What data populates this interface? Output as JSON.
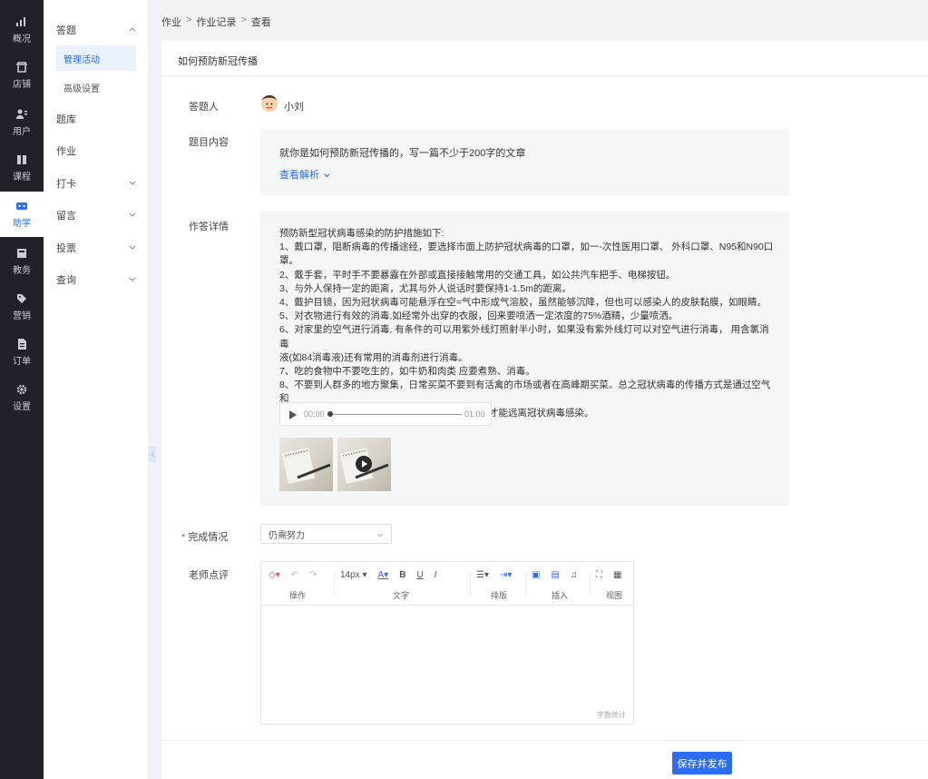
{
  "rail": {
    "items": [
      {
        "label": "概况"
      },
      {
        "label": "店铺"
      },
      {
        "label": "用户"
      },
      {
        "label": "课程"
      },
      {
        "label": "助学"
      },
      {
        "label": "教务"
      },
      {
        "label": "营销"
      },
      {
        "label": "订单"
      },
      {
        "label": "设置"
      }
    ],
    "active_label": "助学"
  },
  "sidebar": {
    "group1": "答题",
    "sub1": "管理活动",
    "sub2": "高级设置",
    "item_tiku": "题库",
    "item_zuoye": "作业",
    "item_daka": "打卡",
    "item_liuyan": "留言",
    "item_toupiao": "投票",
    "item_chaxun": "查询"
  },
  "breadcrumb": {
    "part1": "作业",
    "part2": "作业记录",
    "part3": "查看",
    "sep": ">"
  },
  "card": {
    "title": "如何预防新冠传播"
  },
  "form": {
    "answerer_label": "答题人",
    "answerer_name": "小刘",
    "question_label": "题目内容",
    "question_text": "就你是如何预防新冠传播的，写一篇不少于200字的文章",
    "view_analysis": "查看解析",
    "answer_label": "作答详情",
    "answer_lines": [
      "预防新型冠状病毒感染的防护措施如下:",
      "1、戴口罩，阻断病毒的传播途经，要选择市面上防护冠状病毒的口罩，如一-次性医用口罩、 外科口罩、N95和N90口",
      "罩。",
      "2、戴手套，平时手不要暴露在外部或直接接触常用的交通工具，如公共汽车把手、电梯按钮。",
      "3、与外人保持一定的距离，尤其与外人说话时要保持1-1.5m的距离。",
      "4、戴护目镜，因为冠状病毒可能悬浮在空=气中形成气溶胶，虽然能够沉降，但也可以感染人的皮肤黏膜，如眼睛。",
      "5、对衣物进行有效的消毒,如经常外出穿的衣服，回来要喷洒一定浓度的75%酒精，少量喷洒。",
      "6、对家里的空气进行消毒, 有条件的可以用紫外线灯照射半小时，如果没有紫外线灯可以对空气进行消毒， 用含氯消毒",
      "液(如84消毒液)还有常用的消毒剂进行消毒。",
      "7、吃的食物中不要吃生的，如牛奶和肉类 应要煮熟、消毒。",
      "8、不要到人群多的地方聚集，日常买菜不要到有活禽的市场或者在高峰期买菜。总之冠状病毒的传播方式是通过空气和",
      "呼吸道传播，只有保护好自己，阻断任何传播途径才能远离冠状病毒感染。"
    ],
    "audio_current": "00:00",
    "audio_total": "01:00",
    "audio_progress": 0,
    "completion_label": "完成情况",
    "completion_value": "仍需努力",
    "teacher_comment_label": "老师点评"
  },
  "editor": {
    "font_size": "14px",
    "group_labels": {
      "operate": "操作",
      "text": "文字",
      "layout": "排版",
      "insert": "插入",
      "view": "视图"
    },
    "word_count_label": "字数统计"
  },
  "actions": {
    "publish": "保存并发布"
  },
  "colors": {
    "accent": "#2d6cf5",
    "rail_bg": "#1f2329",
    "required": "#e5484d"
  }
}
